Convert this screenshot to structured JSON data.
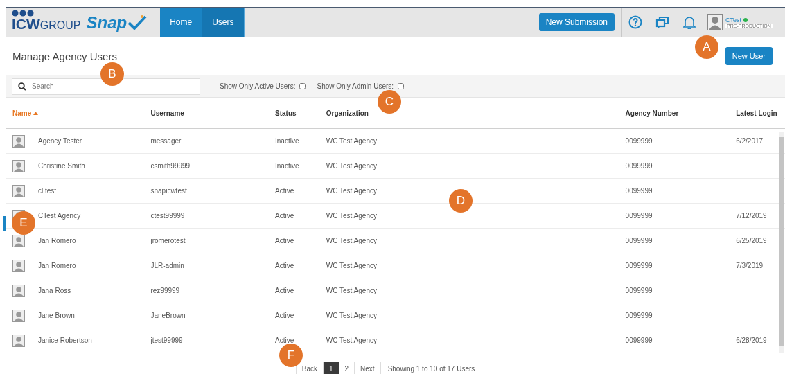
{
  "header": {
    "logo": {
      "brand": "ICW",
      "group": "GROUP",
      "product": "Snap"
    },
    "tabs": [
      {
        "label": "Home",
        "selected": false
      },
      {
        "label": "Users",
        "selected": true
      }
    ],
    "new_submission": "New Submission",
    "user": {
      "name": "CTest",
      "online": true,
      "environment": "PRE-PRODUCTION"
    }
  },
  "page_title": "Manage Agency Users",
  "new_user_button": "New User",
  "filters": {
    "search_placeholder": "Search",
    "options": [
      {
        "label": "Show Only Active Users:",
        "checked": false
      },
      {
        "label": "Show Only Admin Users:",
        "checked": false
      }
    ]
  },
  "table": {
    "columns": [
      {
        "label": "Name",
        "sorted": true
      },
      {
        "label": "Username",
        "sorted": false
      },
      {
        "label": "Status",
        "sorted": false
      },
      {
        "label": "Organization",
        "sorted": false
      },
      {
        "label": "Agency Number",
        "sorted": false
      },
      {
        "label": "Latest Login",
        "sorted": false
      }
    ],
    "rows": [
      {
        "name": "Agency Tester",
        "username": "messager",
        "status": "Inactive",
        "organization": "WC Test Agency",
        "agency_number": "0099999",
        "latest_login": "6/2/2017"
      },
      {
        "name": "Christine Smith",
        "username": "csmith99999",
        "status": "Inactive",
        "organization": "WC Test Agency",
        "agency_number": "0099999",
        "latest_login": ""
      },
      {
        "name": "cl test",
        "username": "snapicwtest",
        "status": "Active",
        "organization": "WC Test Agency",
        "agency_number": "0099999",
        "latest_login": ""
      },
      {
        "name": "CTest Agency",
        "username": "ctest99999",
        "status": "Active",
        "organization": "WC Test Agency",
        "agency_number": "0099999",
        "latest_login": "7/12/2019"
      },
      {
        "name": "Jan Romero",
        "username": "jromerotest",
        "status": "Active",
        "organization": "WC Test Agency",
        "agency_number": "0099999",
        "latest_login": "6/25/2019"
      },
      {
        "name": "Jan Romero",
        "username": "JLR-admin",
        "status": "Active",
        "organization": "WC Test Agency",
        "agency_number": "0099999",
        "latest_login": "7/3/2019"
      },
      {
        "name": "Jana Ross",
        "username": "rez99999",
        "status": "Active",
        "organization": "WC Test Agency",
        "agency_number": "0099999",
        "latest_login": ""
      },
      {
        "name": "Jane Brown",
        "username": "JaneBrown",
        "status": "Active",
        "organization": "WC Test Agency",
        "agency_number": "0099999",
        "latest_login": ""
      },
      {
        "name": "Janice Robertson",
        "username": "jtest99999",
        "status": "Active",
        "organization": "WC Test Agency",
        "agency_number": "0099999",
        "latest_login": "6/28/2019"
      }
    ]
  },
  "pagination": {
    "back": "Back",
    "pages": [
      {
        "label": "1",
        "selected": true
      },
      {
        "label": "2",
        "selected": false
      }
    ],
    "next": "Next",
    "summary": "Showing 1 to 10 of 17 Users"
  },
  "callouts": [
    "A",
    "B",
    "C",
    "D",
    "E",
    "F"
  ]
}
